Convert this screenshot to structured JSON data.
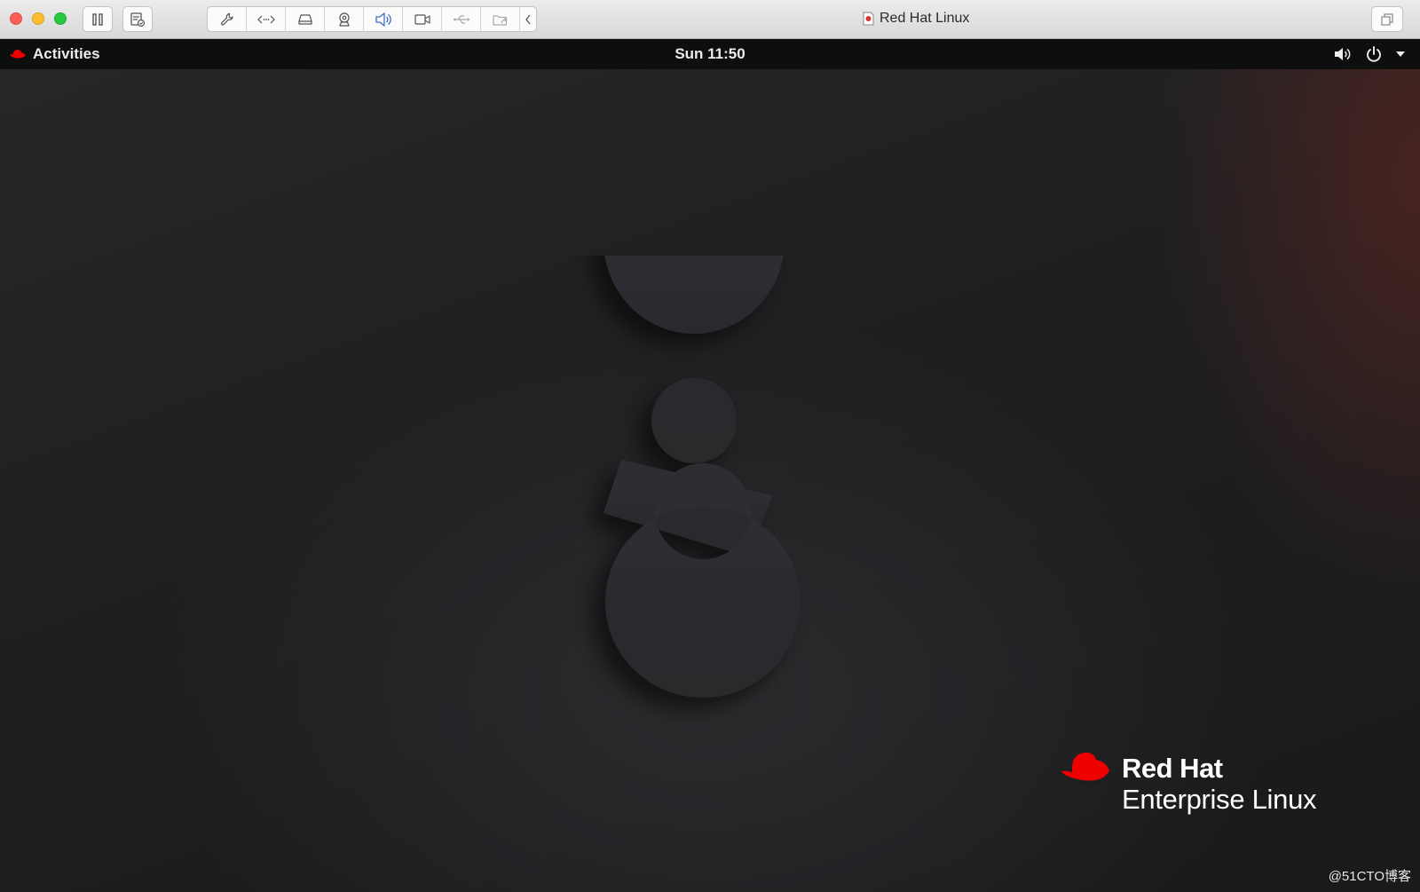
{
  "mac_window": {
    "title": "Red Hat Linux",
    "traffic_lights": {
      "close_color": "#fe5f57",
      "minimize_color": "#febc2e",
      "zoom_color": "#28c840"
    },
    "toolbar_icons": [
      "pause-icon",
      "snapshot-icon",
      "settings-wrench-icon",
      "network-icon",
      "hard-disk-icon",
      "camera-device-icon",
      "sound-icon",
      "video-camera-icon",
      "usb-icon",
      "shared-folder-icon",
      "collapse-chevron-icon"
    ]
  },
  "gnome_topbar": {
    "activities_label": "Activities",
    "clock": "Sun 11:50",
    "tray_icons": [
      "volume-icon",
      "power-icon",
      "dropdown-arrow-icon"
    ]
  },
  "desktop": {
    "wallpaper_numeral": "8",
    "brand": {
      "line1": "Red Hat",
      "line2": "Enterprise Linux",
      "hat_color": "#ee0000"
    },
    "watermark": "@51CTO博客"
  }
}
